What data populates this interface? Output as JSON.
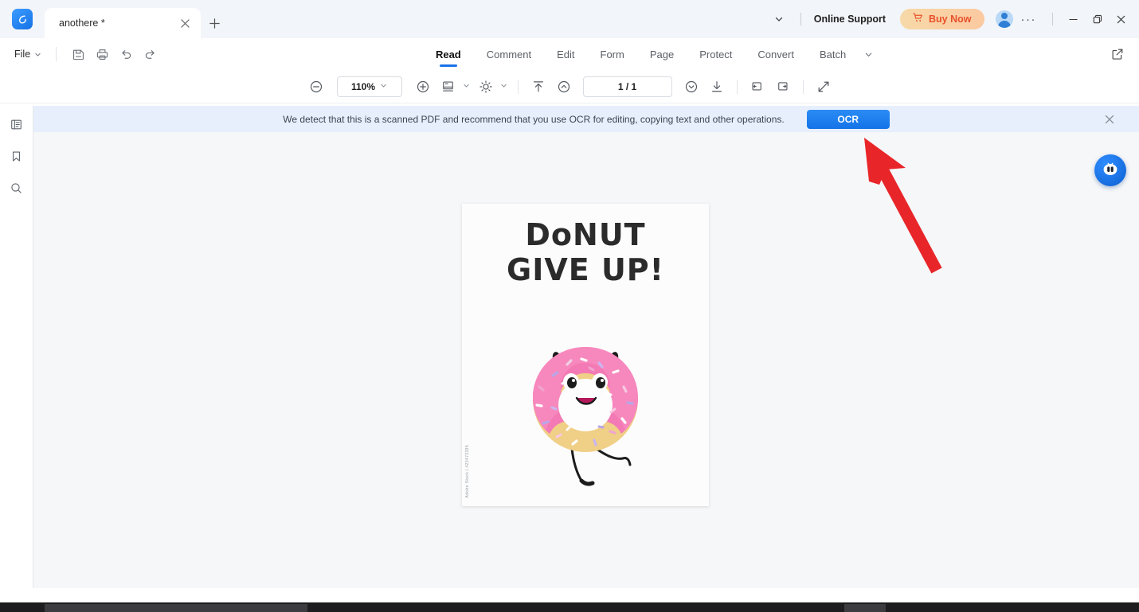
{
  "window": {
    "tab": {
      "title": "anothere *",
      "close_icon": "close-icon"
    },
    "new_tab_icon": "plus-icon",
    "logo_icon": "app-logo-icon",
    "chevron_icon": "chevron-down-icon",
    "online_support": "Online Support",
    "buy_now": "Buy Now",
    "cart_icon": "cart-icon",
    "avatar_icon": "user-avatar-icon",
    "more_icon": "more-options-icon",
    "minimize_icon": "minimize-icon",
    "maximize_icon": "maximize-icon",
    "close_icon": "close-icon"
  },
  "menubar": {
    "file_label": "File",
    "quick_actions": [
      "save-icon",
      "print-icon",
      "undo-icon",
      "redo-icon"
    ],
    "tabs": [
      {
        "label": "Read",
        "active": true
      },
      {
        "label": "Comment",
        "active": false
      },
      {
        "label": "Edit",
        "active": false
      },
      {
        "label": "Form",
        "active": false
      },
      {
        "label": "Page",
        "active": false
      },
      {
        "label": "Protect",
        "active": false
      },
      {
        "label": "Convert",
        "active": false
      },
      {
        "label": "Batch",
        "active": false
      }
    ],
    "overflow_icon": "chevron-down-icon",
    "share_icon": "external-link-icon"
  },
  "toolbar": {
    "zoom_out_icon": "zoom-out-icon",
    "zoom_level": "110%",
    "zoom_in_icon": "zoom-in-icon",
    "page_layout_icon": "page-layout-icon",
    "brightness_icon": "brightness-icon",
    "fit_top_icon": "scroll-to-top-icon",
    "prev_page_icon": "previous-page-icon",
    "page_indicator": "1 / 1",
    "next_page_icon": "next-page-icon",
    "download_icon": "download-icon",
    "single_page_icon": "single-page-view-icon",
    "facing_page_icon": "facing-page-view-icon",
    "fullscreen_icon": "fullscreen-icon"
  },
  "banner": {
    "message": "We detect that this is a scanned PDF and recommend that you use OCR for editing, copying text and other operations.",
    "button_label": "OCR",
    "close_icon": "close-icon",
    "background": "#e7effd",
    "button_color": "#1473e8"
  },
  "sidebar": {
    "items": [
      {
        "name": "thumbnails-panel",
        "icon": "thumbnails-icon"
      },
      {
        "name": "bookmarks-panel",
        "icon": "bookmark-icon"
      },
      {
        "name": "search-panel",
        "icon": "search-icon"
      }
    ]
  },
  "document": {
    "line1": "DoNUT",
    "line2": "GIVE UP!",
    "credit": "Adobe Stock | 423473395",
    "illustration": "donut-character-illustration"
  },
  "floating": {
    "ai_assistant_icon": "ai-assistant-icon"
  },
  "annotation": {
    "arrow_color": "#e8262a",
    "arrow_name": "red-pointer-arrow"
  }
}
